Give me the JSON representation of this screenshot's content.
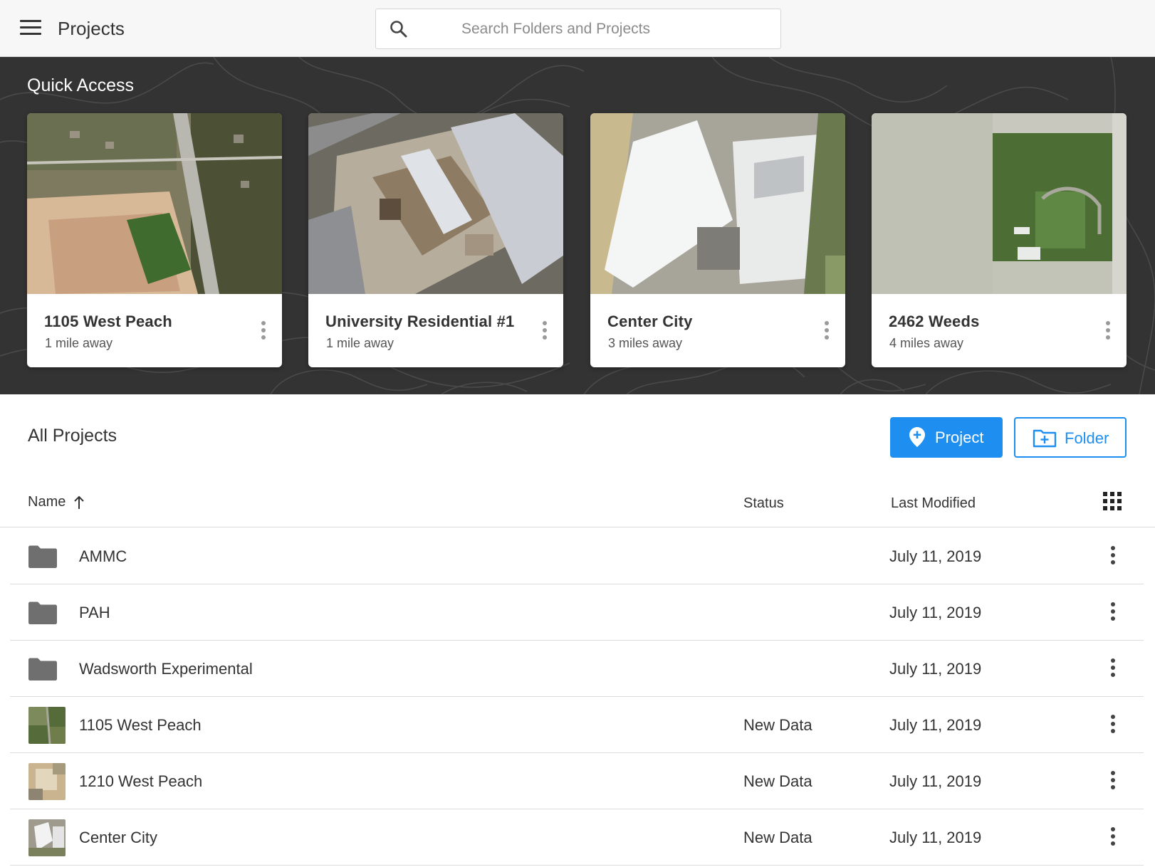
{
  "header": {
    "title": "Projects",
    "search": {
      "placeholder": "Search Folders and Projects",
      "value": ""
    }
  },
  "quick_access": {
    "title": "Quick Access",
    "cards": [
      {
        "title": "1105 West Peach",
        "distance": "1 mile away"
      },
      {
        "title": "University Residential #1",
        "distance": "1 mile away"
      },
      {
        "title": "Center City",
        "distance": "3 miles away"
      },
      {
        "title": "2462 Weeds",
        "distance": "4 miles away"
      }
    ]
  },
  "all_projects": {
    "title": "All Projects",
    "new_project_label": "Project",
    "new_folder_label": "Folder",
    "columns": {
      "name": "Name",
      "status": "Status",
      "last_modified": "Last Modified"
    },
    "sort": {
      "column": "Name",
      "direction": "ascending"
    },
    "rows": [
      {
        "type": "folder",
        "name": "AMMC",
        "status": "",
        "modified": "July 11, 2019"
      },
      {
        "type": "folder",
        "name": "PAH",
        "status": "",
        "modified": "July 11, 2019"
      },
      {
        "type": "folder",
        "name": "Wadsworth Experimental",
        "status": "",
        "modified": "July 11, 2019"
      },
      {
        "type": "project",
        "name": "1105 West Peach",
        "status": "New Data",
        "modified": "July 11, 2019"
      },
      {
        "type": "project",
        "name": "1210 West Peach",
        "status": "New Data",
        "modified": "July 11, 2019"
      },
      {
        "type": "project",
        "name": "Center City",
        "status": "New Data",
        "modified": "July 11, 2019"
      }
    ]
  },
  "colors": {
    "accent": "#1e8ff0",
    "hero_background": "#333333",
    "topbar_background": "#f7f7f7",
    "folder_icon": "#6f6f6f"
  },
  "icons": {
    "menu": "menu-icon",
    "search": "search-icon",
    "more": "more-vertical-icon",
    "sort": "arrow-up-icon",
    "grid_view": "grid-view-icon",
    "add_project": "map-pin-plus-icon",
    "add_folder": "folder-plus-icon",
    "folder": "folder-icon"
  }
}
